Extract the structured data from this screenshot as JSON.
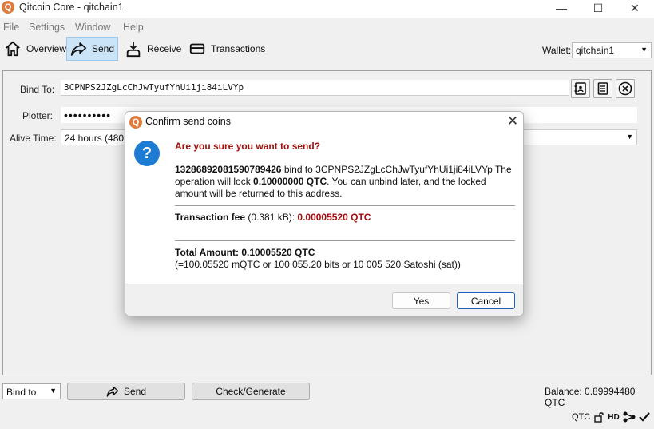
{
  "window": {
    "title": "Qitcoin Core - qitchain1",
    "app_icon_glyph": "Q",
    "minimize": "—",
    "maximize": "☐",
    "close": "✕"
  },
  "menu": [
    "File",
    "Settings",
    "Window",
    "Help"
  ],
  "toolbar": {
    "overview": "Overview",
    "send": "Send",
    "receive": "Receive",
    "transactions": "Transactions",
    "wallet_label": "Wallet:",
    "wallet_value": "qitchain1"
  },
  "form": {
    "bind_to_label": "Bind To:",
    "bind_to_value": "3CPNPS2JZgLcChJwTyufYhUi1ji84iLVYp",
    "plotter_label": "Plotter:",
    "plotter_value": "••••••••••",
    "alive_time_label": "Alive Time:",
    "alive_time_value": "24 hours (480 b"
  },
  "bottom": {
    "mode_select": "Bind to",
    "send_button": "Send",
    "check_button": "Check/Generate",
    "balance": "Balance: 0.89994480 QTC"
  },
  "status": {
    "unit": "QTC",
    "hd": "HD"
  },
  "dialog": {
    "title": "Confirm send coins",
    "question": "Are you sure you want to send?",
    "plotter_id": "13286892081590789426",
    "bind_text": " bind to 3CPNPS2JZgLcChJwTyufYhUi1ji84iLVYp The operation will lock ",
    "lock_amount": "0.10000000 QTC",
    "bind_text2": ". You can unbind later, and the locked amount will be returned to this address.",
    "fee_label": "Transaction fee",
    "fee_size": " (0.381 kB): ",
    "fee_value": "0.00005520 QTC",
    "total_label": "Total Amount: 0.10005520 QTC",
    "total_detail": "(=100.05520 mQTC or 100 055.20 bits or 10 005 520 Satoshi (sat))",
    "yes": "Yes",
    "cancel": "Cancel"
  },
  "colors": {
    "accent": "#1e7bd4",
    "warning_text": "#a01010",
    "brand": "#e07b39"
  }
}
